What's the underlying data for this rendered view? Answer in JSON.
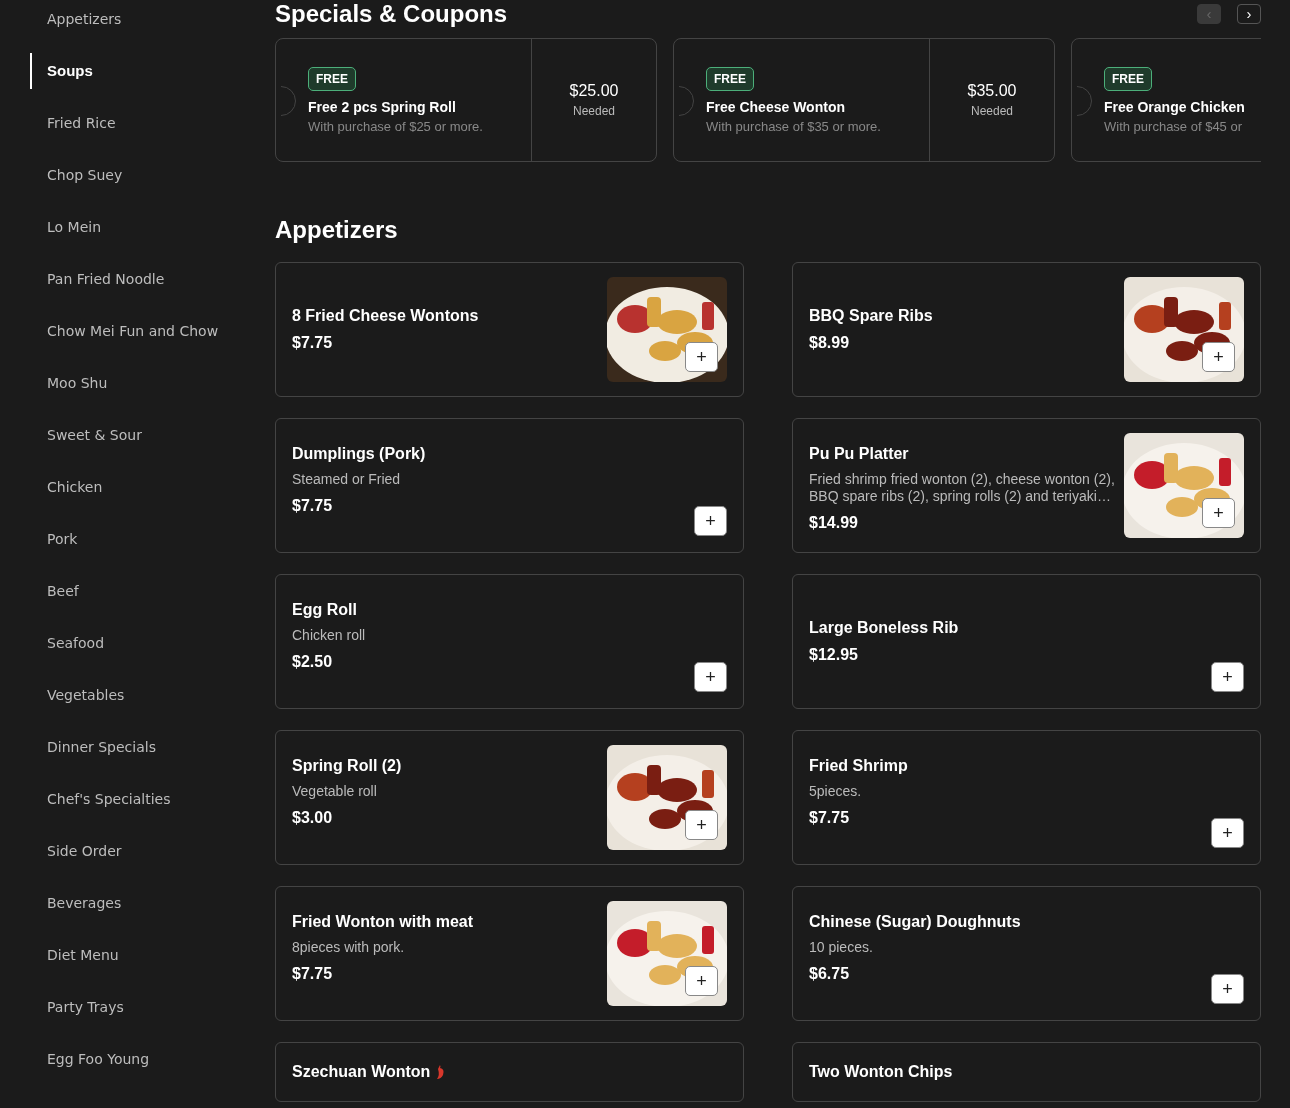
{
  "sidebar": {
    "items": [
      {
        "label": "Appetizers",
        "selected": false
      },
      {
        "label": "Soups",
        "selected": true
      },
      {
        "label": "Fried Rice",
        "selected": false
      },
      {
        "label": "Chop Suey",
        "selected": false
      },
      {
        "label": "Lo Mein",
        "selected": false
      },
      {
        "label": "Pan Fried Noodle",
        "selected": false
      },
      {
        "label": "Chow Mei Fun and Chow",
        "selected": false
      },
      {
        "label": "Moo Shu",
        "selected": false
      },
      {
        "label": "Sweet & Sour",
        "selected": false
      },
      {
        "label": "Chicken",
        "selected": false
      },
      {
        "label": "Pork",
        "selected": false
      },
      {
        "label": "Beef",
        "selected": false
      },
      {
        "label": "Seafood",
        "selected": false
      },
      {
        "label": "Vegetables",
        "selected": false
      },
      {
        "label": "Dinner Specials",
        "selected": false
      },
      {
        "label": "Chef's Specialties",
        "selected": false
      },
      {
        "label": "Side Order",
        "selected": false
      },
      {
        "label": "Beverages",
        "selected": false
      },
      {
        "label": "Diet Menu",
        "selected": false
      },
      {
        "label": "Party Trays",
        "selected": false
      },
      {
        "label": "Egg Foo Young",
        "selected": false
      }
    ]
  },
  "specials": {
    "title": "Specials & Coupons",
    "prev_disabled": true,
    "next_disabled": false,
    "prev": "‹",
    "next": "›",
    "coupons": [
      {
        "badge": "FREE",
        "title": "Free 2 pcs Spring Roll",
        "description": "With purchase of $25 or more.",
        "amount": "$25.00",
        "amount_label": "Needed"
      },
      {
        "badge": "FREE",
        "title": "Free Cheese Wonton",
        "description": "With purchase of $35 or more.",
        "amount": "$35.00",
        "amount_label": "Needed"
      },
      {
        "badge": "FREE",
        "title": "Free Orange Chicken",
        "description": "With purchase of $45 or"
      }
    ]
  },
  "section": {
    "title": "Appetizers",
    "add": "+",
    "items": [
      {
        "name": "8 Fried Cheese Wontons",
        "price": "$7.75",
        "kind": "picture"
      },
      {
        "name": "BBQ Spare Ribs",
        "price": "$8.99",
        "kind": "picture"
      },
      {
        "name": "Dumplings (Pork)",
        "description": "Steamed or Fried",
        "price": "$7.75"
      },
      {
        "name": "Pu Pu Platter",
        "description": "Fried shrimp fried wonton (2), cheese wonton (2), BBQ spare ribs (2), spring rolls (2) and teriyaki…",
        "price": "$14.99",
        "kind": "picture"
      },
      {
        "name": "Egg Roll",
        "description": "Chicken roll",
        "price": "$2.50"
      },
      {
        "name": "Large Boneless Rib",
        "price": "$12.95"
      },
      {
        "name": "Spring Roll (2)",
        "description": "Vegetable roll",
        "price": "$3.00",
        "kind": "picture"
      },
      {
        "name": "Fried Shrimp",
        "description": "5pieces.",
        "price": "$7.75"
      },
      {
        "name": "Fried Wonton with meat",
        "description": "8pieces with pork.",
        "price": "$7.75",
        "kind": "picture"
      },
      {
        "name": "Chinese (Sugar) Doughnuts",
        "description": "10 pieces.",
        "price": "$6.75"
      },
      {
        "name": "Szechuan Wonton",
        "spicy": true
      },
      {
        "name": "Two Wonton Chips"
      }
    ]
  }
}
